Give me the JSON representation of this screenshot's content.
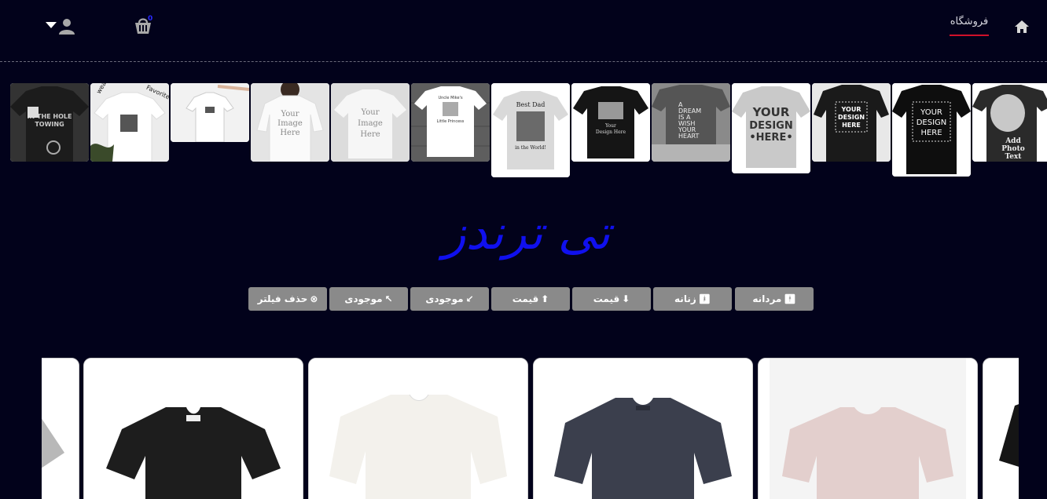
{
  "nav": {
    "shop_label": "فروشگاه",
    "cart_count": "0"
  },
  "thumbnails": [
    {
      "name": "thumb-tow-shirt",
      "text": "IN THE HOLE TOWING"
    },
    {
      "name": "thumb-song-shirt",
      "text": "Favorite song"
    },
    {
      "name": "thumb-hanger-shirt",
      "text": ""
    },
    {
      "name": "thumb-woman-shirt",
      "text": "Your Image Here"
    },
    {
      "name": "thumb-white-tee",
      "text": "Your Image Here"
    },
    {
      "name": "thumb-wood-tee",
      "text": "Uncle Mike's Little Princess"
    },
    {
      "name": "thumb-best-dad",
      "text": "Best Dad in the World"
    },
    {
      "name": "thumb-black-design",
      "text": "Your Design Here"
    },
    {
      "name": "thumb-dream-wish",
      "text": "A DREAM IS A WISH YOUR HEART MAKES."
    },
    {
      "name": "thumb-grey-design",
      "text": "YOUR DESIGN HERE"
    },
    {
      "name": "thumb-man-design",
      "text": "YOUR DESIGN HERE"
    },
    {
      "name": "thumb-black-design-2",
      "text": "YOUR DESIGN HERE"
    },
    {
      "name": "thumb-photo-text",
      "text": "Add Photo Text"
    }
  ],
  "title": "تی ترندز",
  "filters": {
    "men": "مردانه",
    "women": "زنانه",
    "price_down": "قیمت",
    "price_up": "قیمت",
    "stock_down": "موجودی",
    "stock_up": "موجودی",
    "clear": "حذف فیلتر"
  },
  "products": [
    {
      "name": "product-grey-partial",
      "color": "#b8b8b8"
    },
    {
      "name": "product-black-tee",
      "color": "#1d1d1d"
    },
    {
      "name": "product-white-tee",
      "color": "#f3f1ec"
    },
    {
      "name": "product-navy-tee",
      "color": "#3b3f4d"
    },
    {
      "name": "product-pink-tee",
      "color": "#e3cfcd"
    },
    {
      "name": "product-black-partial",
      "color": "#151515"
    }
  ],
  "colors": {
    "background": "#02021b",
    "title": "#1010ee",
    "filter_button": "#8a8a8a",
    "active_underline": "#d0102a"
  }
}
